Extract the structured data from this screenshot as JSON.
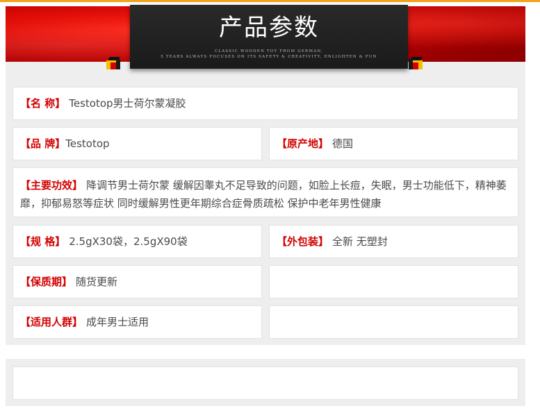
{
  "header": {
    "title": "产品参数",
    "tagline_line1": "CLASSIC WOODEN TOY FROM GERMAN,",
    "tagline_line2": "5 YEARS ALWAYS FOCUSES ON ITS SAFETY & CREATIVITY, ENLIGHTEN & FUN"
  },
  "params": {
    "name": {
      "label": "【名 称】",
      "value": "Testotop男士荷尔蒙凝胶"
    },
    "brand": {
      "label": "【品 牌】",
      "value": "Testotop"
    },
    "origin": {
      "label": "【原产地】",
      "value": "德国"
    },
    "efficacy": {
      "label": "【主要功效】",
      "value": "降调节男士荷尔蒙 缓解因睾丸不足导致的问题，如脸上长痘，失眠，男士功能低下，精神萎靡，抑郁易怒等症状 同时缓解男性更年期综合症骨质疏松 保护中老年男性健康"
    },
    "spec": {
      "label": "【规 格】",
      "value": "2.5gX30袋，2.5gX90袋"
    },
    "package": {
      "label": "【外包装】",
      "value": "全新 无塑封"
    },
    "shelf_life": {
      "label": "【保质期】",
      "value": "随货更新"
    },
    "audience": {
      "label": "【适用人群】",
      "value": "成年男士适用"
    }
  },
  "colors": {
    "accent_red": "#d40000",
    "banner_red": "#e00d08",
    "gold": "#f3a21c"
  }
}
